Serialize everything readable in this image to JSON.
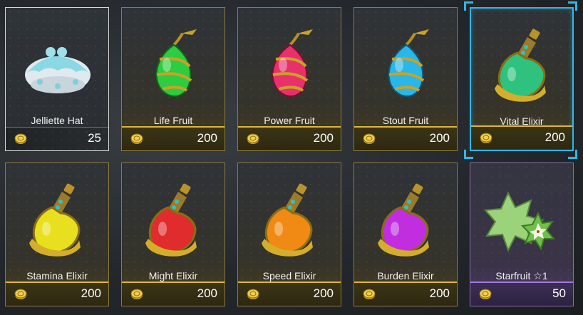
{
  "shop": {
    "items": [
      {
        "name": "Jelliette Hat",
        "price": "25",
        "icon": "jelliette-hat-icon",
        "rarity": "common"
      },
      {
        "name": "Life Fruit",
        "price": "200",
        "icon": "life-fruit-icon",
        "rarity": "rare",
        "color": "#2ecc40"
      },
      {
        "name": "Power Fruit",
        "price": "200",
        "icon": "power-fruit-icon",
        "rarity": "rare",
        "color": "#e8306a"
      },
      {
        "name": "Stout Fruit",
        "price": "200",
        "icon": "stout-fruit-icon",
        "rarity": "rare",
        "color": "#29b6e8"
      },
      {
        "name": "Vital Elixir",
        "price": "200",
        "icon": "vital-elixir-icon",
        "rarity": "rare",
        "color": "#2ec27e",
        "selected": true
      },
      {
        "name": "Stamina Elixir",
        "price": "200",
        "icon": "stamina-elixir-icon",
        "rarity": "rare",
        "color": "#e8e01e"
      },
      {
        "name": "Might Elixir",
        "price": "200",
        "icon": "might-elixir-icon",
        "rarity": "rare",
        "color": "#e02c2c"
      },
      {
        "name": "Speed Elixir",
        "price": "200",
        "icon": "speed-elixir-icon",
        "rarity": "rare",
        "color": "#f08a14"
      },
      {
        "name": "Burden Elixir",
        "price": "200",
        "icon": "burden-elixir-icon",
        "rarity": "rare",
        "color": "#c02ee0"
      },
      {
        "name": "Starfruit ☆1",
        "price": "50",
        "icon": "starfruit-icon",
        "rarity": "epic",
        "color": "#9bd37a"
      }
    ]
  },
  "colors": {
    "selection": "#2fb7e8",
    "rare_border": "#e0b63a",
    "epic_border": "#a47be0"
  }
}
